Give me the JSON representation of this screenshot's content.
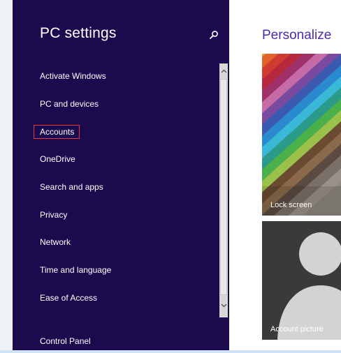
{
  "sidebar": {
    "title": "PC settings",
    "items": [
      {
        "label": "Activate Windows"
      },
      {
        "label": "PC and devices"
      },
      {
        "label": "Accounts",
        "selected": true
      },
      {
        "label": "OneDrive"
      },
      {
        "label": "Search and apps"
      },
      {
        "label": "Privacy"
      },
      {
        "label": "Network"
      },
      {
        "label": "Time and language"
      },
      {
        "label": "Ease of Access"
      }
    ],
    "footer_link": "Control Panel"
  },
  "main": {
    "title": "Personalize",
    "tiles": [
      {
        "label": "Lock screen"
      },
      {
        "label": "Account picture"
      }
    ]
  },
  "colors": {
    "sidebar_bg": "#1b0a4e",
    "accent": "#4b2bb0",
    "selection_outline": "#e03a3a"
  },
  "icons": {
    "search": "search-icon",
    "scroll_up": "chevron-up-icon",
    "scroll_down": "chevron-down-icon"
  }
}
